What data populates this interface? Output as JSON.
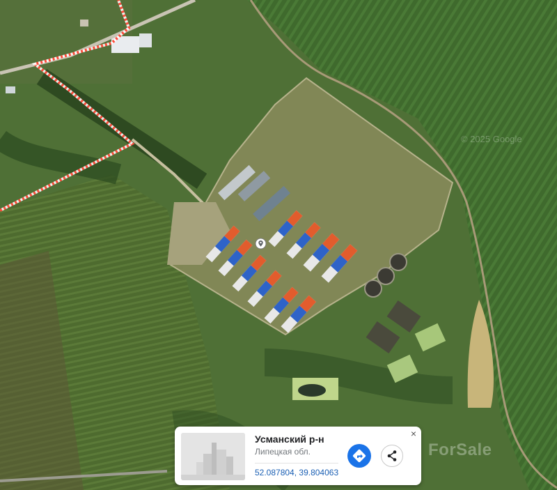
{
  "map": {
    "view": "satellite",
    "boundary_color": "#ff3b30",
    "pin_icon": "location-pin-icon"
  },
  "place_card": {
    "title": "Усманский р-н",
    "subtitle": "Липецкая обл.",
    "coordinates": "52.087804, 39.804063",
    "directions_icon": "directions-icon",
    "share_icon": "share-icon",
    "close_label": "×",
    "accent_color": "#1a73e8"
  },
  "watermarks": {
    "top": "© 2025 Google",
    "bottom": "ForSale"
  }
}
